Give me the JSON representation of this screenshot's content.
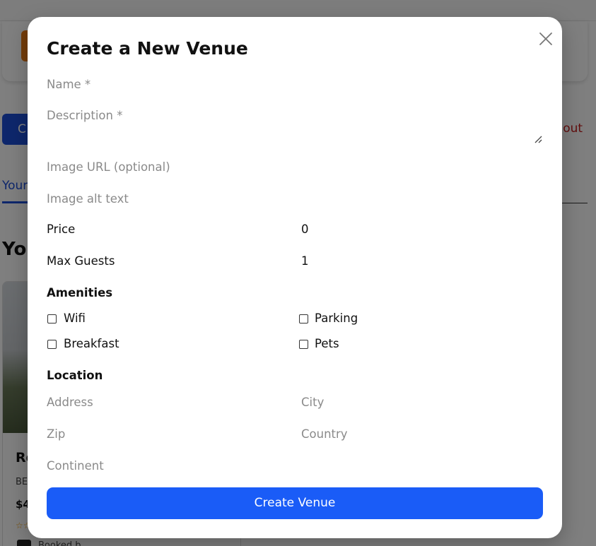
{
  "background": {
    "create_button_text": "C",
    "logout_text": "g out",
    "tab_text": "Your",
    "heading_text": "You",
    "venue_card": {
      "title": "Ro",
      "location": "BE",
      "price": "$4",
      "stars": "☆☆",
      "booked_text": "Booked b"
    }
  },
  "modal": {
    "title": "Create a New Venue",
    "fields": {
      "name": {
        "placeholder": "Name *"
      },
      "description": {
        "placeholder": "Description *"
      },
      "image_url": {
        "placeholder": "Image URL (optional)"
      },
      "image_alt": {
        "placeholder": "Image alt text"
      },
      "price": {
        "label": "Price",
        "value": "0"
      },
      "max_guests": {
        "label": "Max Guests",
        "value": "1"
      }
    },
    "amenities": {
      "title": "Amenities",
      "items": [
        {
          "label": "Wifi",
          "checked": false
        },
        {
          "label": "Parking",
          "checked": false
        },
        {
          "label": "Breakfast",
          "checked": false
        },
        {
          "label": "Pets",
          "checked": false
        }
      ]
    },
    "location": {
      "title": "Location",
      "address": {
        "placeholder": "Address"
      },
      "city": {
        "placeholder": "City"
      },
      "zip": {
        "placeholder": "Zip"
      },
      "country": {
        "placeholder": "Country"
      },
      "continent": {
        "placeholder": "Continent"
      }
    },
    "submit_label": "Create Venue"
  },
  "colors": {
    "primary": "#1a5cf7",
    "logout": "#c41c1c",
    "overlay": "rgba(0,0,0,0.5)"
  }
}
